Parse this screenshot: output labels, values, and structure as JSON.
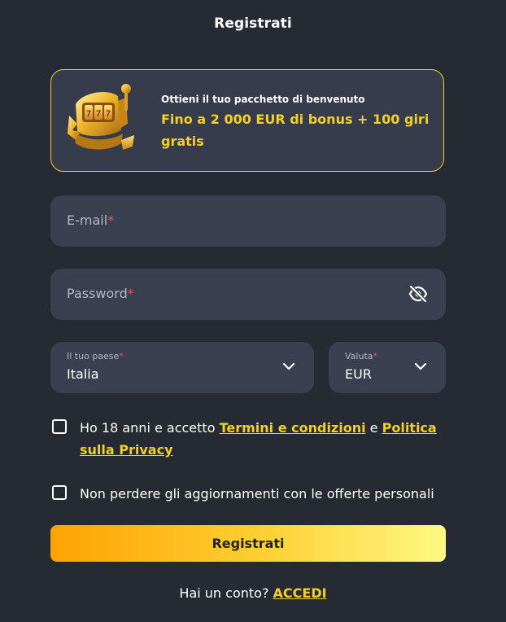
{
  "header": {
    "title": "Registrati"
  },
  "promo": {
    "subtitle": "Ottieni il tuo pacchetto di benvenuto",
    "offer": "Fino a 2 000 EUR di bonus + 100 giri gratis",
    "image_icon": "slot-machine-icon"
  },
  "form": {
    "email": {
      "placeholder": "E-mail",
      "required_mark": "*"
    },
    "password": {
      "placeholder": "Password",
      "required_mark": "*",
      "toggle_icon": "eye-off-icon"
    },
    "country": {
      "label": "Il tuo paese",
      "required_mark": "*",
      "value": "Italia"
    },
    "currency": {
      "label": "Valuta",
      "required_mark": "*",
      "value": "EUR"
    },
    "terms": {
      "text_before": "Ho 18 anni e accetto ",
      "terms_link": "Termini e condizioni",
      "and": " e ",
      "privacy_link": "Politica sulla Privacy",
      "checked": false
    },
    "offers": {
      "text": "Non perdere gli aggiornamenti con le offerte personali",
      "checked": false
    },
    "submit_label": "Registrati"
  },
  "footer": {
    "question": "Hai un conto? ",
    "login_link": "ACCEDI"
  },
  "colors": {
    "background": "#262a33",
    "field": "#3b4050",
    "accent": "#f4d026",
    "required": "#f0514f"
  }
}
